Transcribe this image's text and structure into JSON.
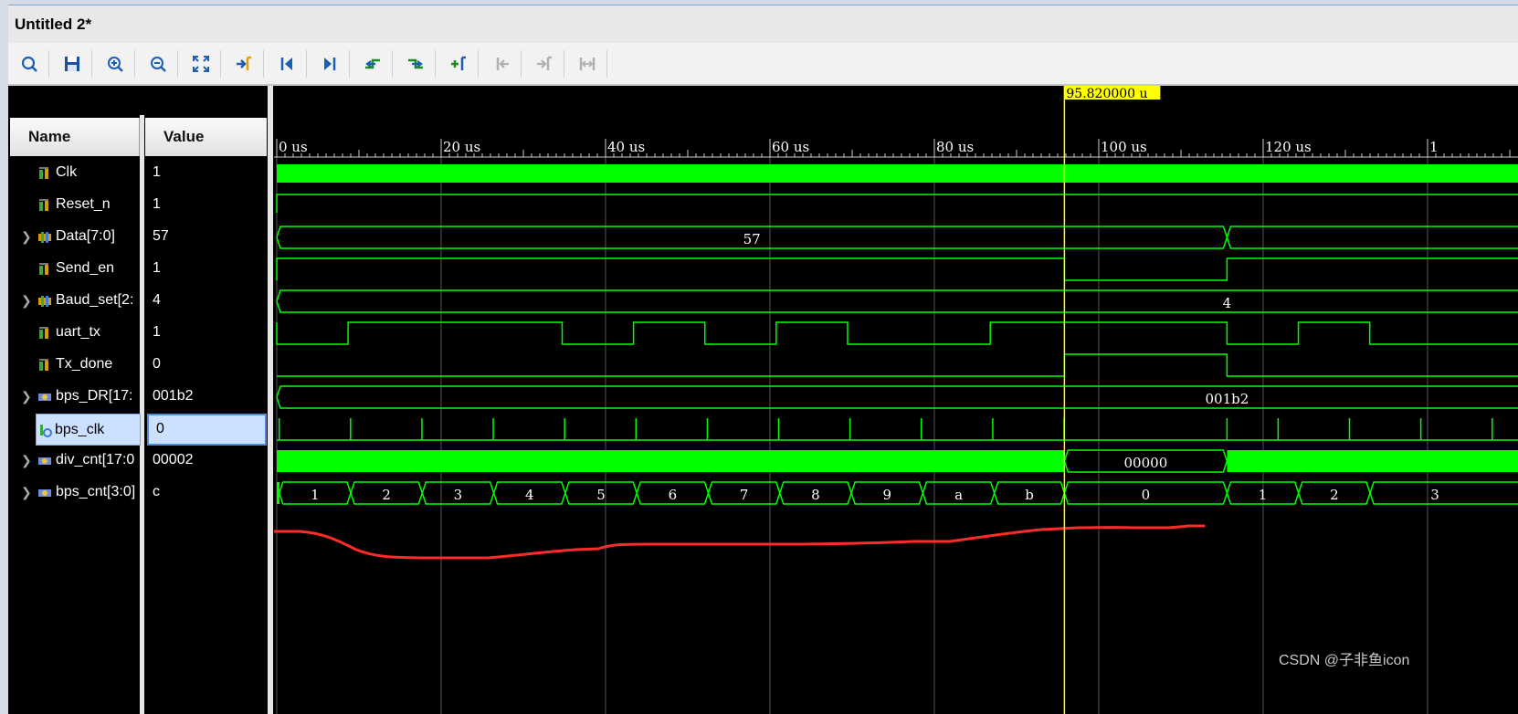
{
  "window": {
    "title": "Untitled 2*"
  },
  "toolbar": {
    "buttons": [
      {
        "name": "search-button",
        "icon": "search-icon",
        "x": 22,
        "enabled": true
      },
      {
        "name": "save-button",
        "icon": "save-icon",
        "enabled": true
      },
      {
        "name": "zoom-in-button",
        "icon": "zoom-in-icon",
        "enabled": true
      },
      {
        "name": "zoom-out-button",
        "icon": "zoom-out-icon",
        "enabled": true
      },
      {
        "name": "zoom-fit-button",
        "icon": "zoom-fit-icon",
        "enabled": true
      },
      {
        "name": "go-to-cursor-button",
        "icon": "go-to-cursor-icon",
        "enabled": true
      },
      {
        "name": "go-to-start-button",
        "icon": "go-to-start-icon",
        "enabled": true
      },
      {
        "name": "go-to-end-button",
        "icon": "go-to-end-icon",
        "enabled": true
      },
      {
        "name": "previous-transition-button",
        "icon": "previous-transition-icon",
        "enabled": true
      },
      {
        "name": "next-transition-button",
        "icon": "next-transition-icon",
        "enabled": true
      },
      {
        "name": "add-marker-button",
        "icon": "add-marker-icon",
        "enabled": true
      },
      {
        "name": "previous-marker-button",
        "icon": "previous-marker-icon",
        "enabled": false
      },
      {
        "name": "next-marker-button",
        "icon": "next-marker-icon",
        "enabled": false
      },
      {
        "name": "swap-cursors-button",
        "icon": "swap-cursors-icon",
        "enabled": false
      }
    ]
  },
  "columns": {
    "name": "Name",
    "value": "Value"
  },
  "signals": [
    {
      "name": "Clk",
      "value": "1",
      "bus": false,
      "icon": "wire-signal-icon",
      "selected": false
    },
    {
      "name": "Reset_n",
      "value": "1",
      "bus": false,
      "icon": "wire-signal-icon",
      "selected": false
    },
    {
      "name": "Data[7:0]",
      "value": "57",
      "bus": true,
      "icon": "bus-signal-icon",
      "selected": false
    },
    {
      "name": "Send_en",
      "value": "1",
      "bus": false,
      "icon": "wire-signal-icon",
      "selected": false
    },
    {
      "name": "Baud_set[2:",
      "value": "4",
      "bus": true,
      "icon": "bus-signal-icon",
      "selected": false
    },
    {
      "name": "uart_tx",
      "value": "1",
      "bus": false,
      "icon": "wire-signal-icon",
      "selected": false
    },
    {
      "name": "Tx_done",
      "value": "0",
      "bus": false,
      "icon": "wire-signal-icon",
      "selected": false
    },
    {
      "name": "bps_DR[17:",
      "value": "001b2",
      "bus": true,
      "icon": "internal-bus-icon",
      "selected": false
    },
    {
      "name": "bps_clk",
      "value": "0",
      "bus": false,
      "icon": "internal-wire-icon",
      "selected": true
    },
    {
      "name": "div_cnt[17:0",
      "value": "00002",
      "bus": true,
      "icon": "internal-bus-icon",
      "selected": false
    },
    {
      "name": "bps_cnt[3:0]",
      "value": "c",
      "bus": true,
      "icon": "internal-bus-icon",
      "selected": false
    }
  ],
  "timeline": {
    "unit": "us",
    "ticks": [
      "0 us",
      "20 us",
      "40 us",
      "60 us",
      "80 us",
      "100 us",
      "120 us",
      "1"
    ],
    "cursor_label": "95.820000 u",
    "cursor_time": 95.82
  },
  "waveforms": {
    "data_bus_label": "57",
    "baud_set_label": "4",
    "bps_dr_label": "001b2",
    "div_cnt_label": "00000",
    "bps_cnt_labels": [
      "1",
      "2",
      "3",
      "4",
      "5",
      "6",
      "7",
      "8",
      "9",
      "a",
      "b",
      "0",
      "1",
      "2",
      "3"
    ]
  },
  "colors": {
    "waveform": "#00ff00",
    "cursor": "#ffff00",
    "cursor_label_bg": "#ffff00",
    "annotation": "#ff2a2a",
    "selection": "#cce0ff",
    "background": "#000000"
  },
  "watermark": "CSDN @子非鱼icon"
}
